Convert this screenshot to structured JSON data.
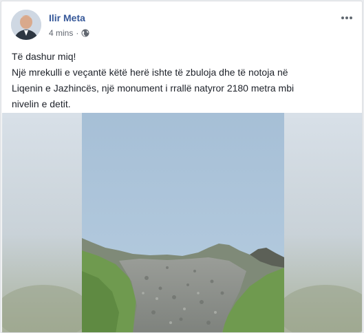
{
  "post": {
    "author": "Ilir Meta",
    "time": "4 mins",
    "separator": "·",
    "privacy_icon": "globe-icon",
    "more_icon": "more-options-icon",
    "text_lines": [
      "Të dashur miq!",
      "Një mrekulli e veçantë këtë herë ishte të zbuloja dhe të notoja në",
      "Liqenin e Jazhincës, një monument i rrallë natyror 2180 metra mbi",
      "nivelin e detit."
    ]
  },
  "colors": {
    "author_link": "#365899",
    "meta_text": "#616770",
    "sky": "#a9c4dc",
    "grass": "#6f9a4f"
  }
}
